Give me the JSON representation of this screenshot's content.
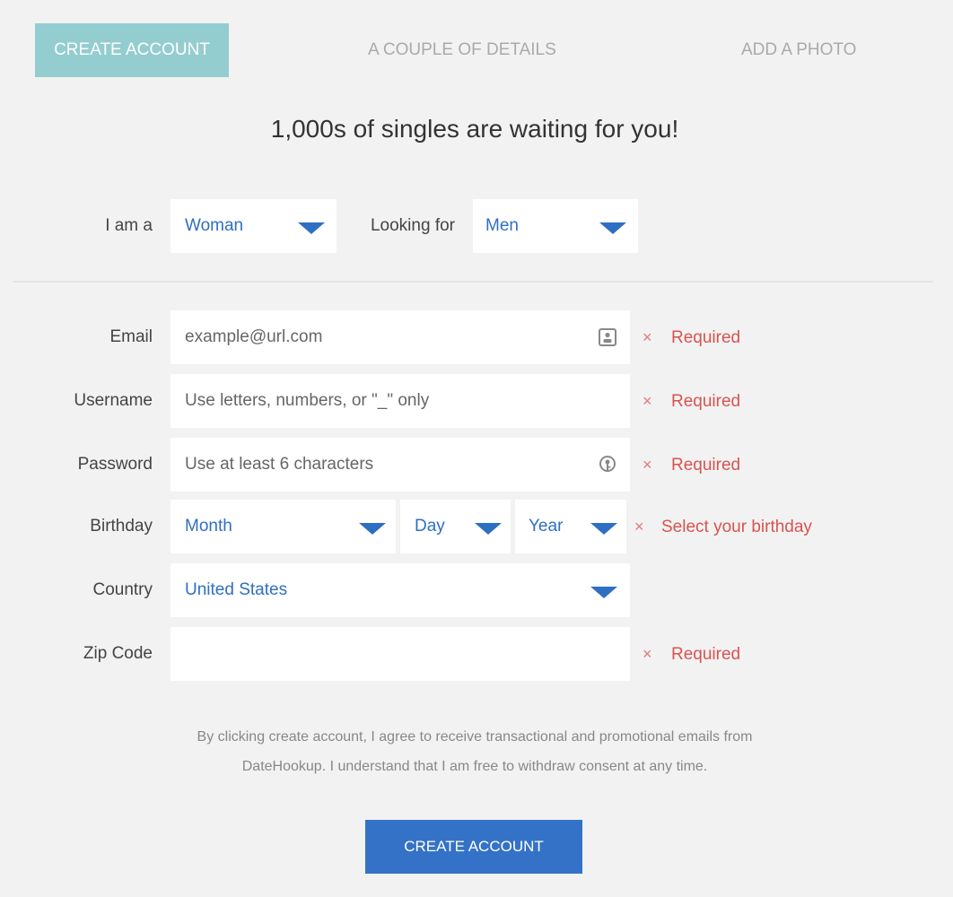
{
  "steps": [
    {
      "label": "CREATE ACCOUNT"
    },
    {
      "label": "A COUPLE OF DETAILS"
    },
    {
      "label": "ADD A PHOTO"
    }
  ],
  "headline": "1,000s of singles are waiting for you!",
  "gender": {
    "label": "I am a",
    "value": "Woman",
    "looking_label": "Looking for",
    "looking_value": "Men"
  },
  "form": {
    "email": {
      "label": "Email",
      "placeholder": "example@url.com",
      "error": "Required"
    },
    "username": {
      "label": "Username",
      "placeholder": "Use letters, numbers, or \"_\" only",
      "error": "Required"
    },
    "password": {
      "label": "Password",
      "placeholder": "Use at least 6 characters",
      "error": "Required"
    },
    "birthday": {
      "label": "Birthday",
      "month": "Month",
      "day": "Day",
      "year": "Year",
      "error": "Select your birthday"
    },
    "country": {
      "label": "Country",
      "value": "United States"
    },
    "zip": {
      "label": "Zip Code",
      "placeholder": "",
      "error": "Required"
    }
  },
  "error_icon": "×",
  "consent": {
    "line1": "By clicking create account, I agree to receive transactional and promotional emails from",
    "line2": "DateHookup. I understand that I am free to withdraw consent at any time."
  },
  "submit_label": "CREATE ACCOUNT",
  "colors": {
    "accent": "#3472c7",
    "step_active": "#94cdd0",
    "error": "#d9534f",
    "background": "#f2f2f2"
  }
}
